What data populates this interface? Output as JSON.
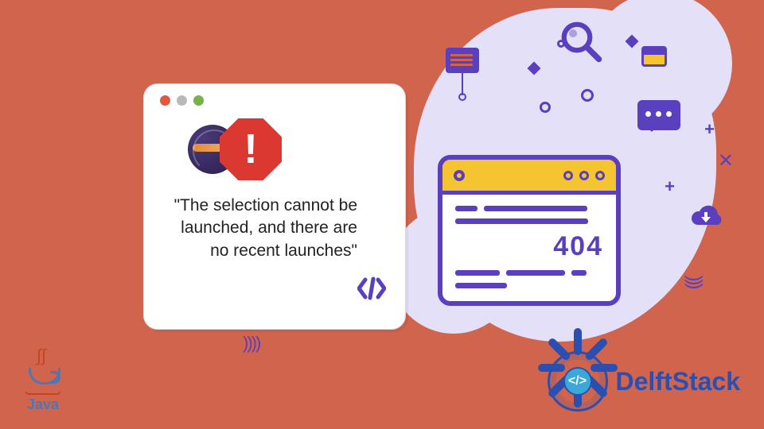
{
  "card": {
    "error_message": "\"The selection cannot be launched, and there are no recent launches\"",
    "stop_symbol": "!",
    "code_symbol": "</>"
  },
  "browser404": {
    "code": "404"
  },
  "java": {
    "label": "Java"
  },
  "delftstack": {
    "label": "DelftStack",
    "badge_symbol": "</>"
  },
  "icons": {
    "magnify": "search-icon",
    "document": "document-icon",
    "speech": "speech-bubble-icon",
    "small_window": "mini-window-icon",
    "cloud": "cloud-upload-icon",
    "eclipse": "eclipse-icon",
    "stop": "stop-sign-icon",
    "code": "code-brackets-icon",
    "traffic_red": "traffic-light-red",
    "traffic_yellow": "traffic-light-yellow",
    "traffic_green": "traffic-light-green"
  },
  "colors": {
    "background": "#d1644c",
    "accent_purple": "#5a3fbf",
    "accent_yellow": "#f5c431",
    "blob": "#e4e0f8",
    "stop_red": "#dc3832",
    "brand_blue": "#2a4fb0"
  }
}
